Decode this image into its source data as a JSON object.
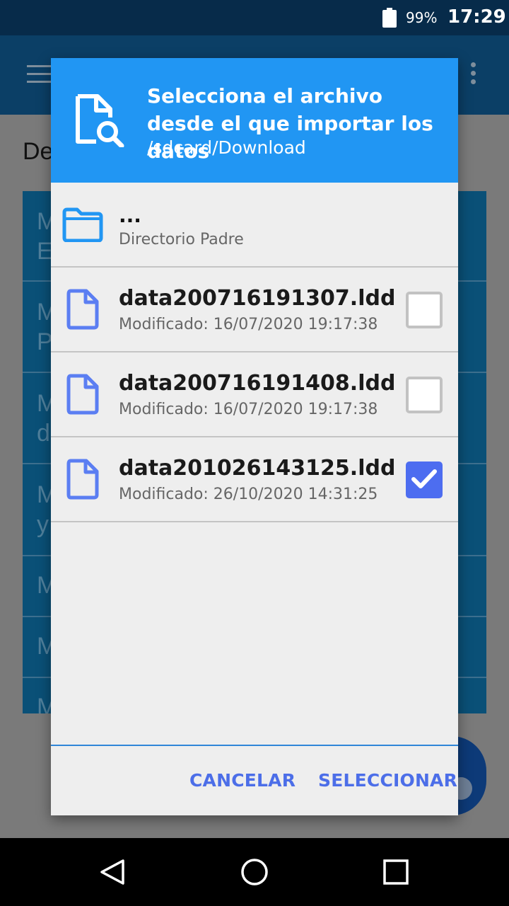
{
  "status_bar": {
    "battery_percent": "99%",
    "time": "17:29",
    "icons": [
      "battery-icon"
    ]
  },
  "background": {
    "heading_fragment": "De",
    "list_rows": [
      {
        "line1": "M",
        "line2": "E"
      },
      {
        "line1": "M",
        "line2": "P"
      },
      {
        "line1": "M",
        "line2": "d"
      },
      {
        "line1": "M",
        "line2": "y"
      },
      {
        "line1": "M",
        "line2": ""
      },
      {
        "line1": "M",
        "line2": ""
      },
      {
        "line1": "M",
        "line2": ""
      }
    ]
  },
  "dialog": {
    "title": "Selecciona el archivo desde el que importar los datos",
    "path": "/sdcard/Download",
    "header_icon": "file-search-icon",
    "parent": {
      "name": "...",
      "subtitle": "Directorio Padre",
      "icon": "folder-icon"
    },
    "files": [
      {
        "name": "data200716191307.ldd",
        "modified": "Modificado: 16/07/2020 19:17:38",
        "checked": false
      },
      {
        "name": "data200716191408.ldd",
        "modified": "Modificado: 16/07/2020 19:17:38",
        "checked": false
      },
      {
        "name": "data201026143125.ldd",
        "modified": "Modificado: 26/10/2020 14:31:25",
        "checked": true
      }
    ],
    "buttons": {
      "cancel": "CANCELAR",
      "select": "SELECCIONAR"
    }
  },
  "nav_bar": {
    "icons": [
      "back-icon",
      "home-icon",
      "recents-icon"
    ]
  },
  "colors": {
    "header": "#2196f3",
    "accent": "#4c6ee8",
    "checkbox_checked": "#4d6df0",
    "status_bar": "#072b4a"
  }
}
